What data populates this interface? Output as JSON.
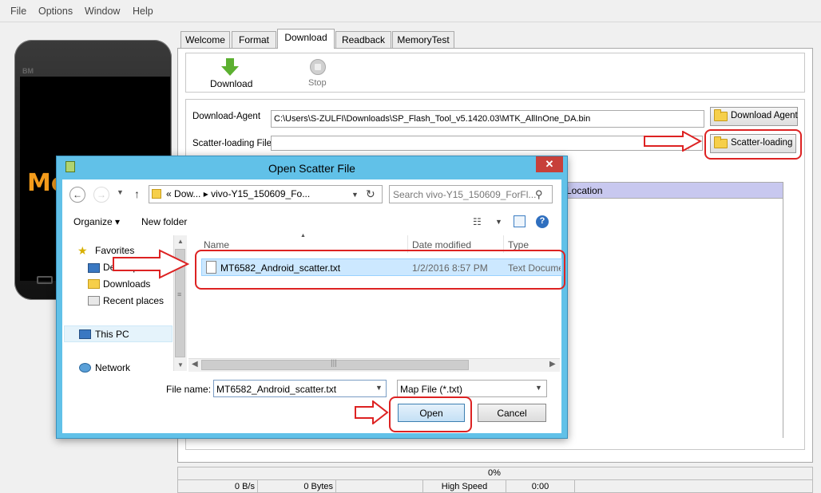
{
  "menu": [
    "File",
    "Options",
    "Window",
    "Help"
  ],
  "phone": {
    "brand": "BM",
    "logo_text": "Me"
  },
  "tabs": [
    "Welcome",
    "Format",
    "Download",
    "Readback",
    "MemoryTest"
  ],
  "toolbar": {
    "download": "Download",
    "stop": "Stop"
  },
  "agent": {
    "download_agent_label": "Download-Agent",
    "download_agent_path": "C:\\Users\\S-ZULFI\\Downloads\\SP_Flash_Tool_v5.1420.03\\MTK_AllInOne_DA.bin",
    "download_agent_button": "Download Agent",
    "scatter_label": "Scatter-loading File",
    "scatter_value": "",
    "scatter_button": "Scatter-loading",
    "location_header": "Location"
  },
  "status": {
    "progress": "0%",
    "speed": "0 B/s",
    "bytes": "0 Bytes",
    "mode": "High Speed",
    "time": "0:00"
  },
  "dialog": {
    "title": "Open Scatter File",
    "close": "✕",
    "address_prefix": "«",
    "address_seg1": "Dow...",
    "address_sep": "▸",
    "address_seg2": "vivo-Y15_150609_Fo...",
    "search_placeholder": "Search vivo-Y15_150609_ForFl...",
    "organize": "Organize",
    "new_folder": "New folder",
    "nav": {
      "favorites": "Favorites",
      "desktop": "Desktop",
      "downloads": "Downloads",
      "recent": "Recent places",
      "this_pc": "This PC",
      "network": "Network"
    },
    "columns": {
      "name": "Name",
      "date": "Date modified",
      "type": "Type"
    },
    "files": [
      {
        "name": "MT6582_Android_scatter.txt",
        "date": "1/2/2016 8:57 PM",
        "type": "Text Document"
      }
    ],
    "filename_label": "File name:",
    "filename_value": "MT6582_Android_scatter.txt",
    "filter_value": "Map File (*.txt)",
    "open": "Open",
    "cancel": "Cancel"
  },
  "colors": {
    "dialog_frame": "#61c1e8",
    "selection": "#cce8ff",
    "annotation": "#dd2222",
    "location_header": "#c8c8ef"
  }
}
